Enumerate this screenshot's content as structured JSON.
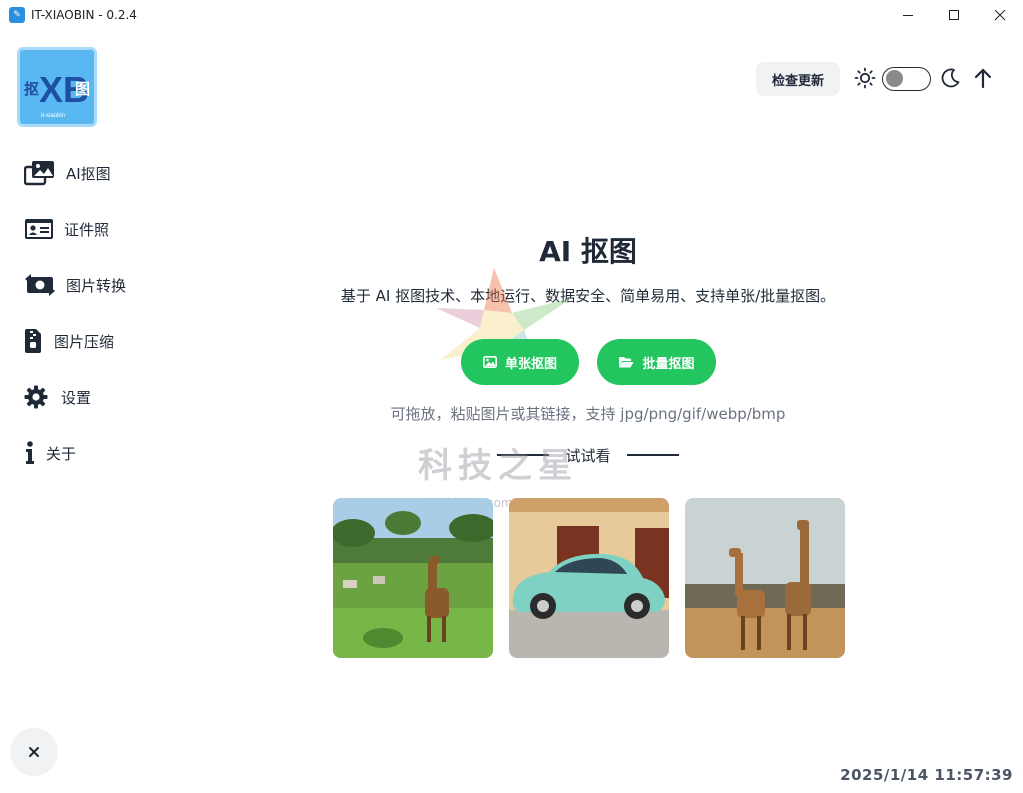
{
  "window": {
    "title": "IT-XIAOBIN - 0.2.4",
    "app_icon": "xb-app-icon"
  },
  "logo": {
    "left_char": "抠",
    "middle": "XB",
    "right_char": "图",
    "caption": "it-xiaobin",
    "colors": {
      "bg": "#59b8f1",
      "text": "#1f4fa3"
    }
  },
  "sidebar": {
    "items": [
      {
        "label": "AI抠图",
        "icon": "images-icon"
      },
      {
        "label": "证件照",
        "icon": "id-card-icon"
      },
      {
        "label": "图片转换",
        "icon": "money-exchange-icon"
      },
      {
        "label": "图片压缩",
        "icon": "file-zipper-icon"
      },
      {
        "label": "设置",
        "icon": "gear-icon"
      },
      {
        "label": "关于",
        "icon": "info-icon"
      }
    ]
  },
  "header": {
    "update_label": "检查更新",
    "theme_toggle": {
      "state": "light",
      "icons": [
        "sun-icon",
        "moon-icon"
      ]
    },
    "scroll_top_icon": "arrow-up-icon"
  },
  "main": {
    "title": "AI 抠图",
    "subtitle": "基于 AI 抠图技术、本地运行、数据安全、简单易用、支持单张/批量抠图。",
    "single_label": "单张抠图",
    "batch_label": "批量抠图",
    "hint": "可拖放，粘贴图片或其链接，支持 jpg/png/gif/webp/bmp",
    "try_label": "试试看",
    "samples": [
      {
        "name": "giraffe-savanna"
      },
      {
        "name": "beetle-car"
      },
      {
        "name": "two-giraffes"
      }
    ]
  },
  "watermark": {
    "text": "科技之星",
    "sub": "kjzhixing.com"
  },
  "status": {
    "clock": "2025/1/14  11:57:39"
  },
  "colors": {
    "accent": "#22c55e",
    "text": "#1f2937",
    "muted": "#6b7280"
  }
}
